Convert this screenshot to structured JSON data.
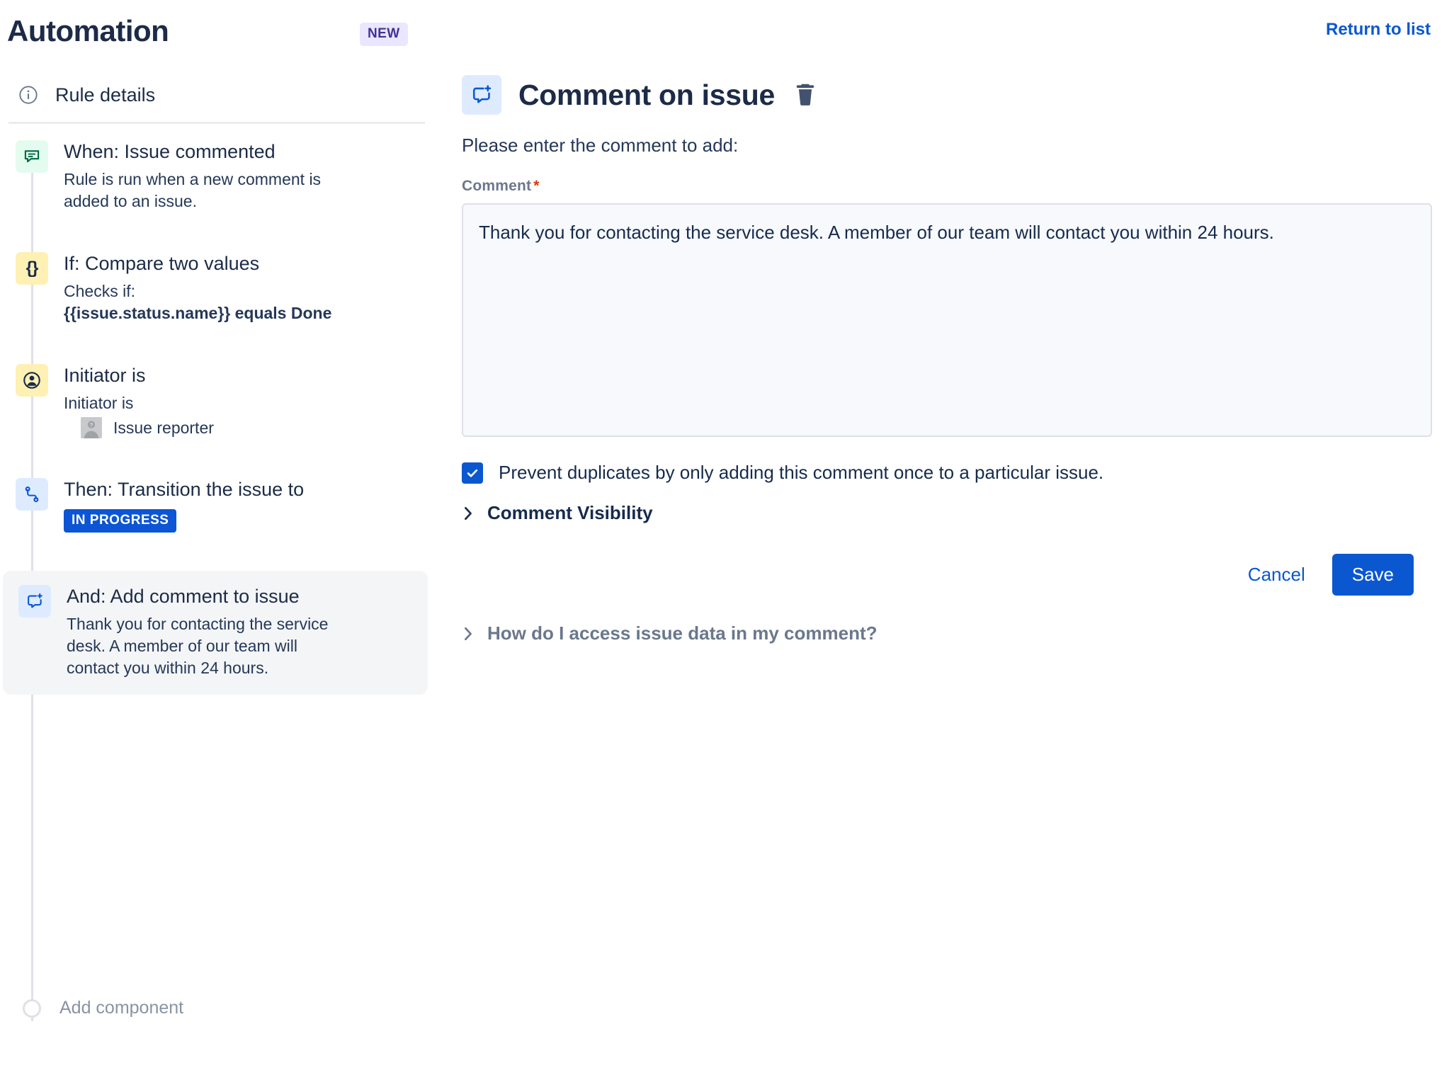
{
  "header": {
    "title": "Automation",
    "badge": "NEW",
    "return_link": "Return to list"
  },
  "sidebar": {
    "rule_details": {
      "label": "Rule details",
      "icon": "info-circle-icon"
    },
    "components": [
      {
        "title": "When: Issue commented",
        "description": "Rule is run when a new comment is added to an issue.",
        "icon": "comment-icon",
        "icon_color": "green",
        "selected": false
      },
      {
        "title": "If: Compare two values",
        "description": "Checks if:",
        "description_bold": "{{issue.status.name}} equals Done",
        "icon": "curly-braces-icon",
        "icon_color": "yellow",
        "selected": false
      },
      {
        "title": "Initiator is",
        "description": "Initiator is",
        "reporter": "Issue reporter",
        "icon": "person-circle-icon",
        "icon_color": "yellow",
        "selected": false
      },
      {
        "title": "Then: Transition the issue to",
        "status_badge": "IN PROGRESS",
        "icon": "workflow-transition-icon",
        "icon_color": "blue",
        "selected": false
      },
      {
        "title": "And: Add comment to issue",
        "description": "Thank you for contacting the service desk. A member of our team will contact you within 24 hours.",
        "icon": "comment-add-icon",
        "icon_color": "blue",
        "selected": true
      }
    ],
    "add_component": "Add component"
  },
  "main": {
    "icon": "comment-add-icon",
    "title": "Comment on issue",
    "delete_icon": "trash-icon",
    "instruction": "Please enter the comment to add:",
    "comment_field": {
      "label": "Comment",
      "required_mark": "*",
      "value": "Thank you for contacting the service desk. A member of our team will contact you within 24 hours.",
      "placeholder": ""
    },
    "prevent_duplicates": {
      "label": "Prevent duplicates by only adding this comment once to a particular issue.",
      "checked": true
    },
    "comment_visibility": {
      "label": "Comment Visibility",
      "expanded": false
    },
    "cancel_label": "Cancel",
    "save_label": "Save",
    "help_link": {
      "label": "How do I access issue data in my comment?",
      "expanded": false
    }
  },
  "colors": {
    "accent_blue": "#0b57d0",
    "badge_blue": "#0c55d4",
    "new_badge_bg": "#eae6ff",
    "new_badge_text": "#403294",
    "required_red": "#de350b",
    "text_dark": "#172b4d",
    "text_muted": "#6b778c"
  }
}
